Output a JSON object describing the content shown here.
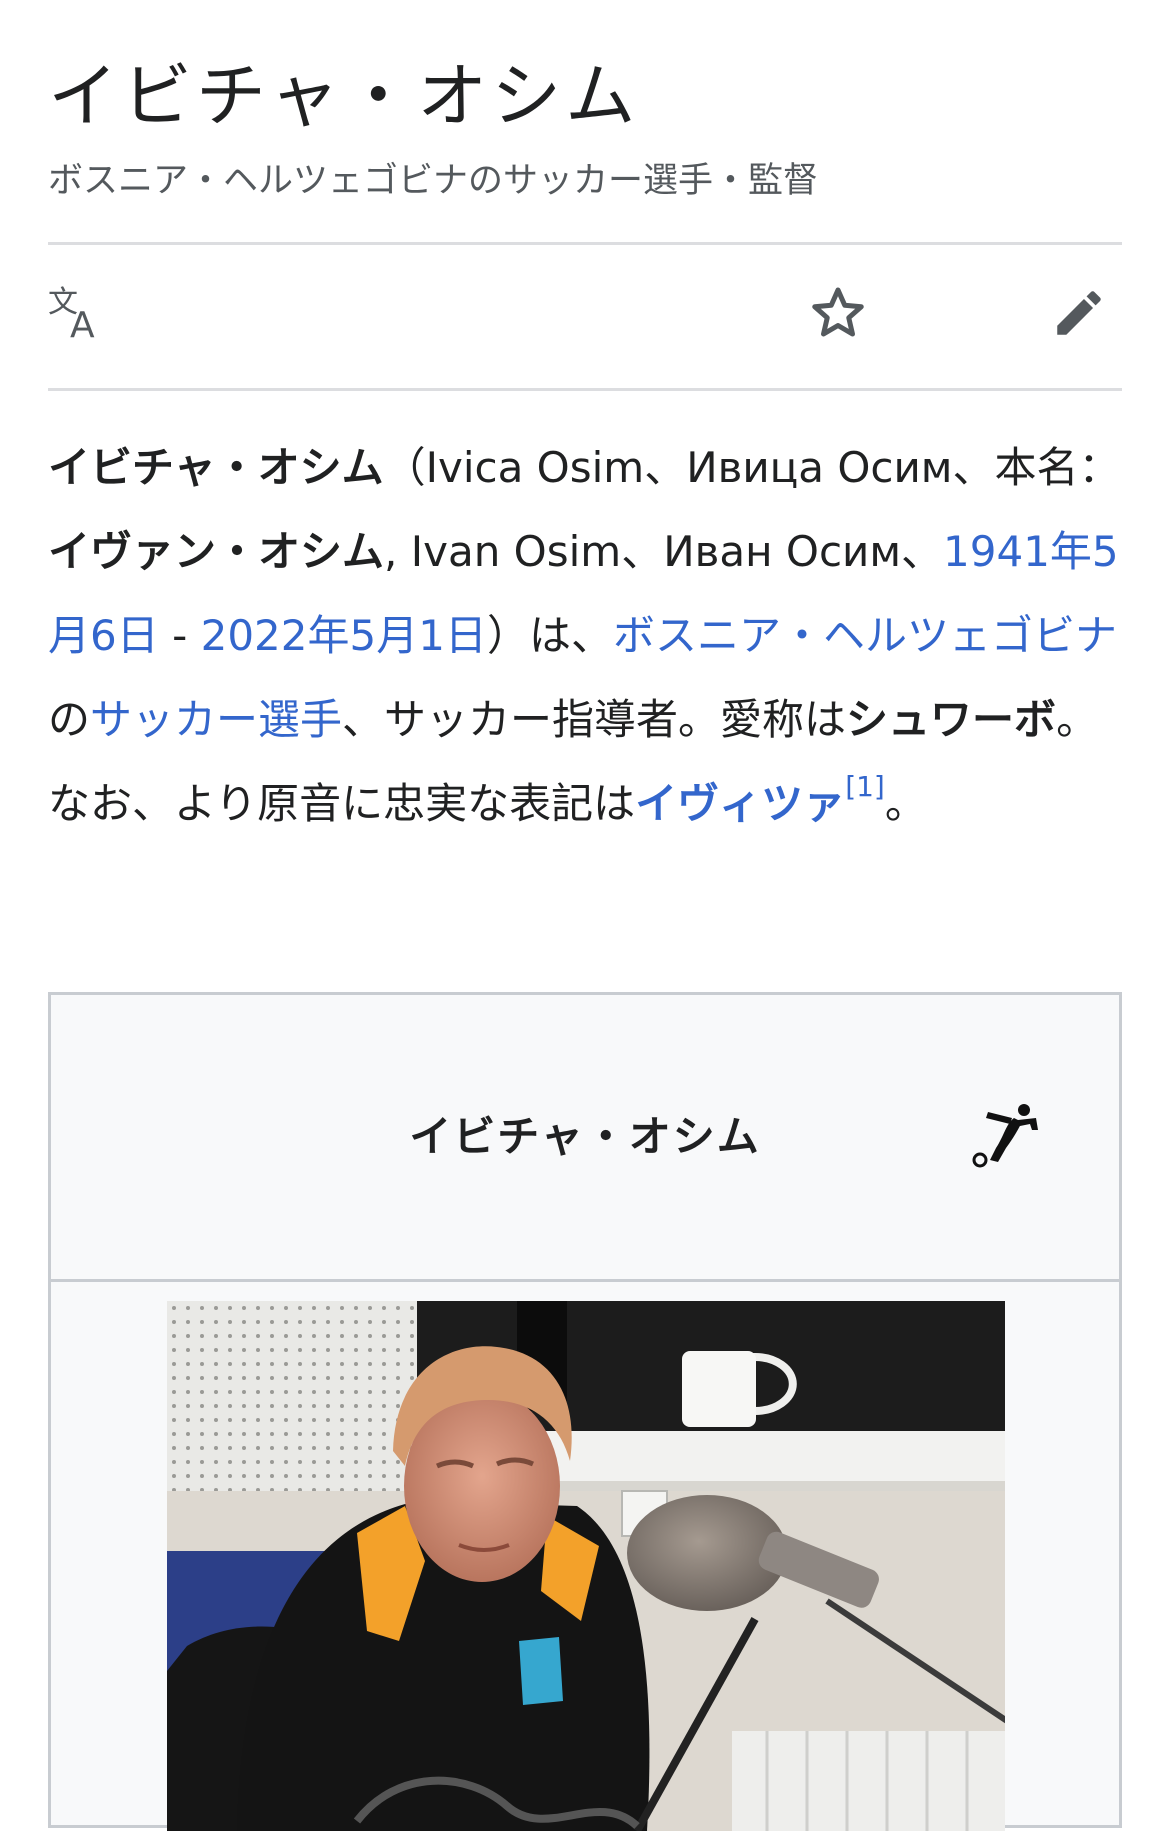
{
  "page": {
    "title": "イビチャ・オシム",
    "subtitle": "ボスニア・ヘルツェゴビナのサッカー選手・監督"
  },
  "toolbar": {
    "icons": [
      "translate-icon",
      "star-icon",
      "edit-icon"
    ]
  },
  "intro": {
    "name_bold": "イビチャ・オシム",
    "t1": "（Ivica Osim、Ивица Осим、本名：",
    "realname_bold": "イヴァン・オシム",
    "t2": ", Ivan Osim、Иван Осим、",
    "birth_link": "1941年5月6日",
    "t3": " - ",
    "death_link": "2022年5月1日",
    "t4": "）は、",
    "country_link": "ボスニア・ヘルツェゴビナ",
    "t5": "の",
    "player_link": "サッカー選手",
    "t6": "、サッカー指導者。愛称は",
    "nickname_bold": "シュワーボ",
    "t7": "。なお、より原音に忠実な表記は",
    "alt_link": "イヴィツァ",
    "ref": "[1]",
    "t8": "。"
  },
  "infobox": {
    "title": "イビチャ・オシム",
    "sport_icon": "football-player-icon",
    "image": "ivica-osim-photo"
  },
  "colors": {
    "link": "#3366cc",
    "text": "#202122",
    "muted": "#54595d",
    "infobox_bg": "#f8f9fa",
    "border": "#c8ccd1"
  }
}
